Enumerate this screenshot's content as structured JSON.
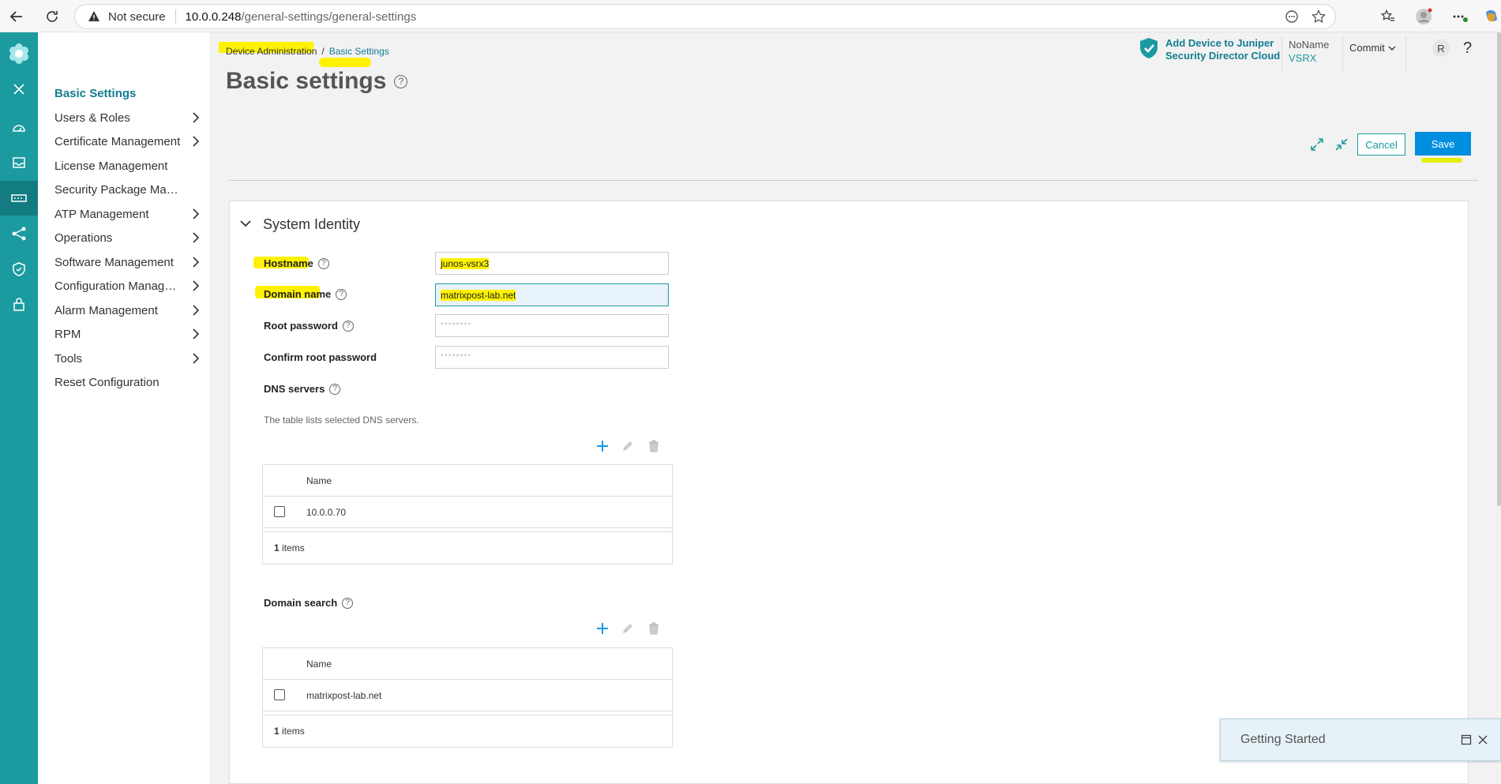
{
  "browser": {
    "not_secure": "Not secure",
    "url_host": "10.0.0.248",
    "url_path": "/general-settings/general-settings"
  },
  "sidebar": {
    "items": [
      {
        "label": "Basic Settings",
        "active": true,
        "has_children": false
      },
      {
        "label": "Users & Roles",
        "has_children": true
      },
      {
        "label": "Certificate Management",
        "has_children": true
      },
      {
        "label": "License Management",
        "has_children": false
      },
      {
        "label": "Security Package Man...",
        "has_children": false
      },
      {
        "label": "ATP Management",
        "has_children": true
      },
      {
        "label": "Operations",
        "has_children": true
      },
      {
        "label": "Software Management",
        "has_children": true
      },
      {
        "label": "Configuration Manage...",
        "has_children": true
      },
      {
        "label": "Alarm Management",
        "has_children": true
      },
      {
        "label": "RPM",
        "has_children": true
      },
      {
        "label": "Tools",
        "has_children": true
      },
      {
        "label": "Reset Configuration",
        "has_children": false
      }
    ]
  },
  "header": {
    "breadcrumb_parent": "Device Administration",
    "breadcrumb_sep": "/",
    "breadcrumb_current": "Basic Settings",
    "title": "Basic settings",
    "juniper_line1": "Add Device to Juniper",
    "juniper_line2": "Security Director Cloud",
    "device_name": "NoName",
    "device_model": "VSRX",
    "commit_label": "Commit",
    "avatar_initial": "R",
    "help": "?"
  },
  "actions": {
    "cancel_label": "Cancel",
    "save_label": "Save"
  },
  "section": {
    "title": "System Identity",
    "hostname_label": "Hostname",
    "hostname_value": "junos-vsrx3",
    "domain_label": "Domain name",
    "domain_value": "matrixpost-lab.net",
    "root_password_label": "Root password",
    "root_password_placeholder": "********",
    "confirm_password_label": "Confirm root password",
    "confirm_password_placeholder": "********",
    "dns_label": "DNS servers",
    "dns_note": "The table lists selected DNS servers.",
    "dns_table": {
      "header": "Name",
      "rows": [
        "10.0.0.70"
      ],
      "footer_count": "1",
      "footer_label": "items"
    },
    "domain_search_label": "Domain search",
    "domain_search_table": {
      "header": "Name",
      "rows": [
        "matrixpost-lab.net"
      ],
      "footer_count": "1",
      "footer_label": "items"
    }
  },
  "getting_started": {
    "title": "Getting Started"
  },
  "colors": {
    "accent": "#1b9aa0",
    "save": "#008fe0",
    "highlight": "#fff200"
  }
}
